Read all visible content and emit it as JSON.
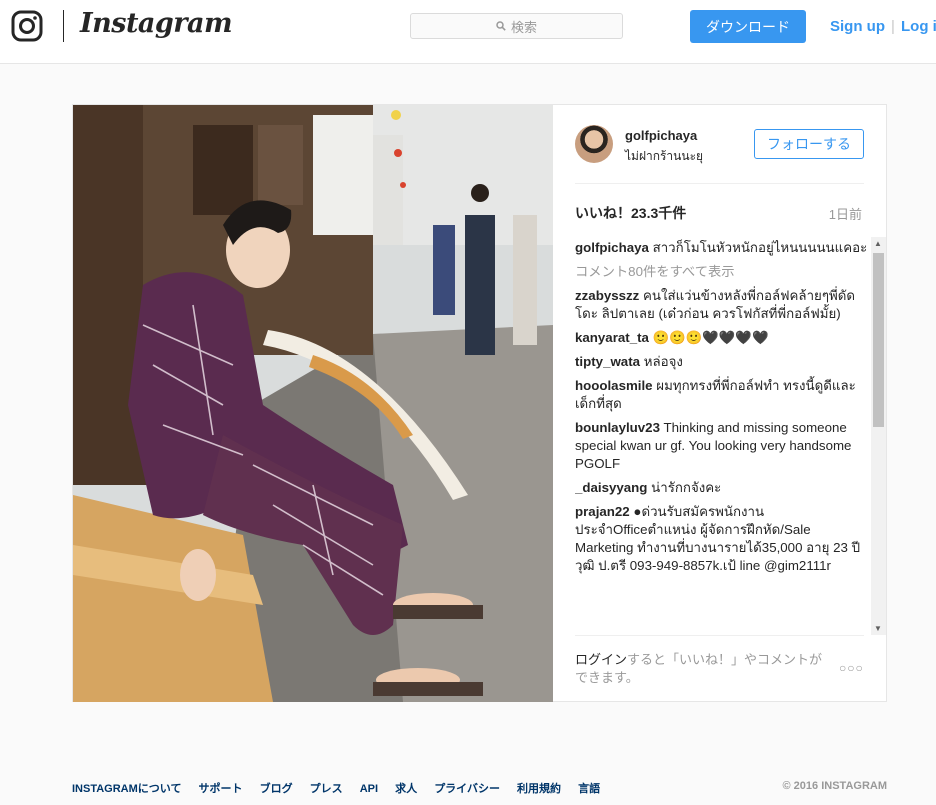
{
  "header": {
    "wordmark": "Instagram",
    "search_placeholder": "検索",
    "download_label": "ダウンロード",
    "signup_label": "Sign up",
    "separator": "|",
    "login_label": "Log i"
  },
  "post": {
    "username": "golfpichaya",
    "location": "ไม่ฝากร้านนะยุ",
    "follow_label": "フォローする",
    "likes": "いいね！23.3千件",
    "posted": "1日前",
    "caption": {
      "user": "golfpichaya",
      "text": "สาวก็โมโนหัวหนักอยู่ไหนนนนนแคอะ"
    },
    "view_all": "コメント80件をすべて表示",
    "comments": [
      {
        "user": "zzabysszz",
        "text": "คนใส่แว่นข้างหลังพี่กอล์ฟคล้ายๆพี่ดัดโดะ ลิปตาเลย (เด๋วก่อน ควรโฟกัสที่พี่กอล์ฟมั้ย)"
      },
      {
        "user": "kanyarat_ta",
        "text": "🙂🙂🙂🖤🖤🖤🖤"
      },
      {
        "user": "tipty_wata",
        "text": "หล่อจุง"
      },
      {
        "user": "hooolasmile",
        "text": "ผมทุกทรงที่พี่กอล์ฟทำ ทรงนี้ดูดีและเด็กที่สุด"
      },
      {
        "user": "bounlayluv23",
        "text": "Thinking and missing someone special kwan ur gf. You looking very handsome PGOLF"
      },
      {
        "user": "_daisyyang",
        "text": "น่ารักกจังคะ"
      },
      {
        "user": "prajan22",
        "text": "●ด่วนรับสมัครพนักงานประจำOfficeตำแหน่ง ผู้จัดการฝึกหัด/Sale Marketing ทำงานที่บางนารายได้35,000 อายุ 23 ปีวุฒิ ป.ตรี 093-949-8857k.เป้ line @gim2111r"
      }
    ],
    "login_link": "ログイン",
    "login_prompt": "すると「いいね！」やコメントができます。",
    "more_dots": "○○○"
  },
  "footer": {
    "links": [
      "INSTAGRAMについて",
      "サポート",
      "ブログ",
      "プレス",
      "API",
      "求人",
      "プライバシー",
      "利用規約",
      "言語"
    ],
    "copyright": "© 2016 INSTAGRAM"
  }
}
